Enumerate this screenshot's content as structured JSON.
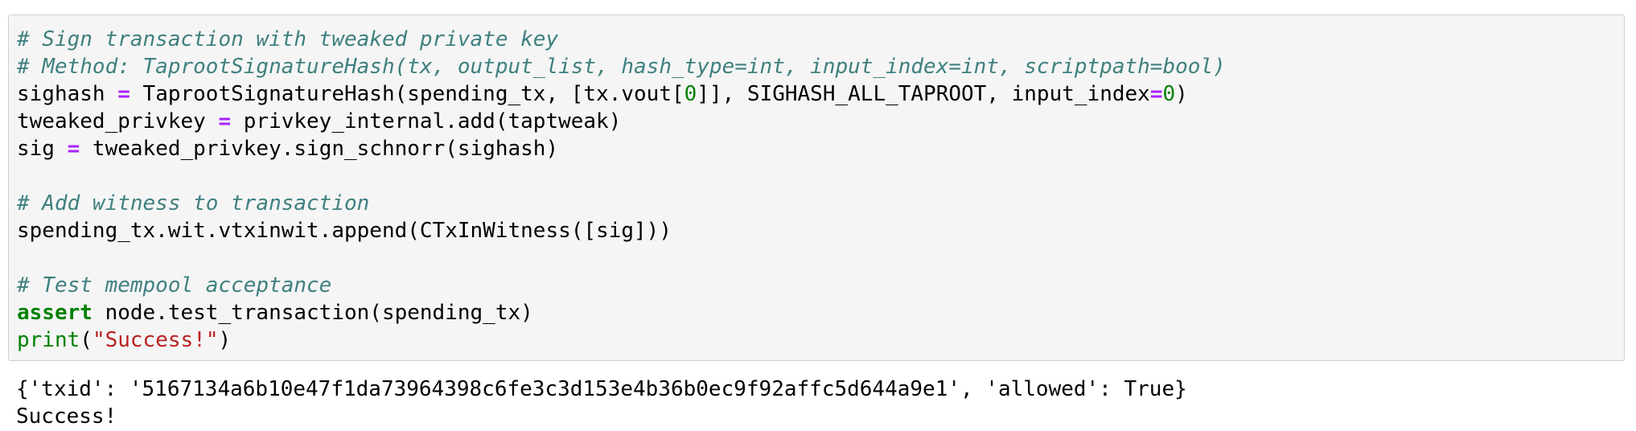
{
  "code_cell": {
    "lines": [
      [
        {
          "t": "# Sign transaction with tweaked private key",
          "c": "comment"
        }
      ],
      [
        {
          "t": "# Method: TaprootSignatureHash(tx, output_list, hash_type=int, input_index=int, scriptpath=bool)",
          "c": "comment"
        }
      ],
      [
        {
          "t": "sighash ",
          "c": "plain"
        },
        {
          "t": "=",
          "c": "op"
        },
        {
          "t": " TaprootSignatureHash(spending_tx, [tx.vout[",
          "c": "plain"
        },
        {
          "t": "0",
          "c": "num"
        },
        {
          "t": "]], SIGHASH_ALL_TAPROOT, input_index",
          "c": "plain"
        },
        {
          "t": "=",
          "c": "op"
        },
        {
          "t": "0",
          "c": "num"
        },
        {
          "t": ")",
          "c": "plain"
        }
      ],
      [
        {
          "t": "tweaked_privkey ",
          "c": "plain"
        },
        {
          "t": "=",
          "c": "op"
        },
        {
          "t": " privkey_internal.add(taptweak)",
          "c": "plain"
        }
      ],
      [
        {
          "t": "sig ",
          "c": "plain"
        },
        {
          "t": "=",
          "c": "op"
        },
        {
          "t": " tweaked_privkey.sign_schnorr(sighash)",
          "c": "plain"
        }
      ],
      [],
      [
        {
          "t": "# Add witness to transaction",
          "c": "comment"
        }
      ],
      [
        {
          "t": "spending_tx.wit.vtxinwit.append(CTxInWitness([sig]))",
          "c": "plain"
        }
      ],
      [],
      [
        {
          "t": "# Test mempool acceptance",
          "c": "comment"
        }
      ],
      [
        {
          "t": "assert",
          "c": "keyword"
        },
        {
          "t": " node.test_transaction(spending_tx)",
          "c": "plain"
        }
      ],
      [
        {
          "t": "print",
          "c": "builtin"
        },
        {
          "t": "(",
          "c": "plain"
        },
        {
          "t": "\"Success!\"",
          "c": "string"
        },
        {
          "t": ")",
          "c": "plain"
        }
      ]
    ]
  },
  "output": {
    "lines": [
      "{'txid': '5167134a6b10e47f1da73964398c6fe3c3d153e4b36b0ec9f92affc5d644a9e1', 'allowed': True}",
      "Success!"
    ]
  },
  "colors": {
    "comment": "#408080",
    "operator": "#aa22ff",
    "number": "#008000",
    "keyword": "#008000",
    "builtin": "#008000",
    "string": "#ba2121",
    "cell_background": "#f5f5f5",
    "cell_border": "#cfcfcf"
  }
}
